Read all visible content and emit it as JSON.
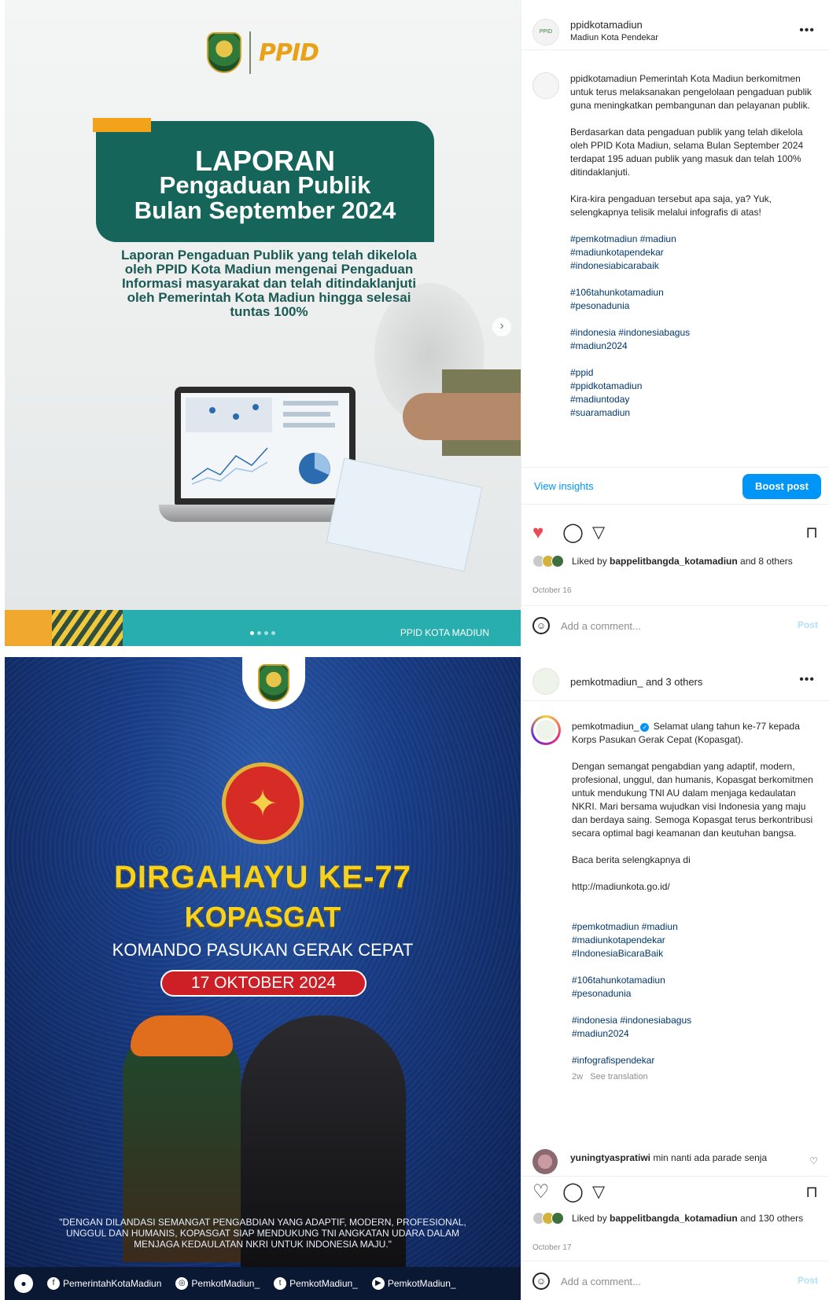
{
  "post1": {
    "media": {
      "ppid_logo": "PPID",
      "title_line1": "LAPORAN",
      "title_line2": "Pengaduan Publik",
      "title_line3": "Bulan September 2024",
      "subtitle": "Laporan Pengaduan Publik yang telah dikelola oleh PPID Kota Madiun mengenai Pengaduan Informasi masyarakat dan telah ditindaklanjuti oleh Pemerintah Kota Madiun hingga selesai tuntas 100%",
      "footer": "PPID KOTA MADIUN"
    },
    "header": {
      "username": "ppidkotamadiun",
      "location": "Madiun Kota Pendekar"
    },
    "caption": {
      "username": "ppidkotamadiun",
      "p1": "Pemerintah Kota Madiun berkomitmen untuk terus melaksanakan pengelolaan pengaduan publik guna meningkatkan pembangunan dan pelayanan publik.",
      "p2": "Berdasarkan data pengaduan publik yang telah dikelola oleh PPID Kota Madiun, selama Bulan September 2024 terdapat 195 aduan publik yang masuk dan telah 100% ditindaklanjuti.",
      "p3": "Kira-kira pengaduan tersebut apa saja, ya? Yuk, selengkapnya telisik melalui infografis di atas!",
      "tags1": "#pemkotmadiun #madiun\n#madiunkotapendekar\n#indonesiabicarabaik",
      "tags2": "#106tahunkotamadiun\n#pesonadunia",
      "tags3": "#indonesia #indonesiabagus\n#madiun2024",
      "tags4": "#ppid\n#ppidkotamadiun\n#madiuntoday\n#suaramadiun"
    },
    "insights": {
      "view_label": "View insights",
      "boost_label": "Boost post"
    },
    "likes": {
      "prefix": "Liked by ",
      "user": "bappelitbangda_kotamadiun",
      "suffix": " and 8 others"
    },
    "date": "October 16",
    "comment": {
      "placeholder": "Add a comment...",
      "post_label": "Post"
    }
  },
  "post2": {
    "media": {
      "dirga": "DIRGAHAYU KE-77",
      "kopasgat": "KOPASGAT",
      "komando": "KOMANDO PASUKAN GERAK CEPAT",
      "date": "17 OKTOBER 2024",
      "quote": "\"DENGAN DILANDASI SEMANGAT PENGABDIAN YANG ADAPTIF, MODERN, PROFESIONAL, UNGGUL DAN HUMANIS, KOPASGAT SIAP MENDUKUNG TNI ANGKATAN UDARA DALAM MENJAGA KEDAULATAN NKRI UNTUK INDONESIA MAJU.\"",
      "social_facebook": "PemerintahKotaMadiun",
      "social_instagram": "PemkotMadiun_",
      "social_twitter": "PemkotMadiun_",
      "social_youtube": "PemkotMadiun_"
    },
    "header": {
      "username": "pemkotmadiun_",
      "others": " and 3 others"
    },
    "caption": {
      "username": "pemkotmadiun_",
      "p1": "Selamat ulang tahun ke-77 kepada Korps Pasukan Gerak Cepat (Kopasgat).",
      "p2": "Dengan semangat pengabdian yang adaptif, modern, profesional, unggul, dan humanis, Kopasgat berkomitmen untuk mendukung TNI AU dalam menjaga kedaulatan NKRI. Mari bersama wujudkan visi Indonesia yang maju dan berdaya saing. Semoga Kopasgat terus berkontribusi secara optimal bagi keamanan dan keutuhan bangsa.",
      "p3": "Baca berita selengkapnya di",
      "p4": "http://madiunkota.go.id/",
      "tags1": "#pemkotmadiun #madiun\n#madiunkotapendekar\n#IndonesiaBicaraBaik",
      "tags2": "#106tahunkotamadiun\n#pesonadunia",
      "tags3": "#indonesia #indonesiabagus\n#madiun2024",
      "tags4": "#infografispendekar",
      "age": "2w",
      "see_translation": "See translation"
    },
    "comment_preview": {
      "user": "yuningtyaspratiwi",
      "text": " min nanti ada parade senja"
    },
    "likes": {
      "prefix": "Liked by ",
      "user": "bappelitbangda_kotamadiun",
      "suffix": " and 130 others"
    },
    "date": "October 17",
    "comment": {
      "placeholder": "Add a comment...",
      "post_label": "Post"
    }
  },
  "colors": {
    "accent": "#0095f6",
    "heart": "#ed4956",
    "teal": "#15655b",
    "gold": "#f6d21f"
  }
}
